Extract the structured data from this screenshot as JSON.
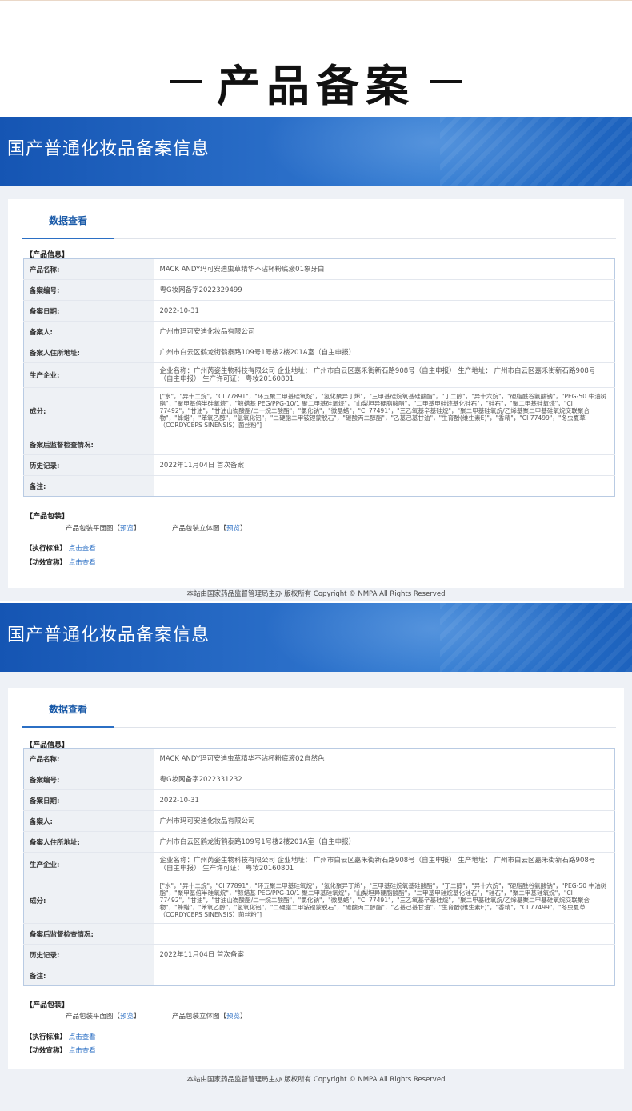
{
  "page_heading": {
    "dash_left": "—",
    "title": "产品备案",
    "dash_right": "—"
  },
  "banner_title": "国产普通化妆品备案信息",
  "tab_label": "数据查看",
  "labels": {
    "product_info": "【产品信息】",
    "product_name": "产品名称:",
    "record_no": "备案编号:",
    "record_date": "备案日期:",
    "registrant": "备案人:",
    "registrant_address": "备案人住所地址:",
    "manufacturer": "生产企业:",
    "ingredients": "成分:",
    "post_check": "备案后监督检查情况:",
    "history": "历史记录:",
    "remarks": "备注:",
    "packaging": "【产品包装】",
    "pkg_flat": "产品包装平面图",
    "pkg_3d": "产品包装立体图",
    "preview": "预览",
    "bracket_open": "【",
    "bracket_close": "】",
    "standard": "【执行标准】",
    "claims": "【功效宣称】",
    "view_link": "点击查看"
  },
  "footer": "本站由国家药品监督管理局主办 版权所有 Copyright © NMPA All Rights Reserved",
  "records": [
    {
      "product_name": "MACK ANDY玛可安迪虫草精华不沾杯粉底液01象牙白",
      "record_no": "粤G妆网备字2022329499",
      "record_date": "2022-10-31",
      "registrant": "广州市玛可安迪化妆品有限公司",
      "registrant_address": "广州市白云区鹤龙街鹤泰路109号1号楼2楼201A室（自主申报）",
      "manufacturer": "企业名称：广州芮姿生物科技有限公司 企业地址：  广州市白云区嘉禾街新石路908号（自主申报） 生产地址：  广州市白云区嘉禾街新石路908号（自主申报） 生产许可证：  粤妆20160801",
      "ingredients": "[\"水\"，\"异十二烷\"，\"CI 77891\"，\"环五聚二甲基硅氧烷\"，\"氢化聚异丁烯\"，\"三甲基硅烷氧基硅酸酯\"，\"丁二醇\"，\"异十六烷\"，\"硬脂酰谷氨酸钠\"，\"PEG-50 牛油树脂\"，\"聚甲基倍半硅氧烷\"，\"鲸蜡基 PEG/PPG-10/1 聚二甲基硅氧烷\"，\"山梨坦异硬脂酸酯\"，\"二甲基甲硅烷基化硅石\"，\"硅石\"，\"聚二甲基硅氧烷\"，\"CI 77492\"，\"甘油\"，\"甘油山嵛酸酯/二十烷二酸酯\"，\"氯化钠\"，\"微晶蜡\"，\"CI 77491\"，\"三乙氧基辛基硅烷\"，\"聚二甲基硅氧烷/乙烯基聚二甲基硅氧烷交联聚合物\"，\"蜂蜡\"，\"苯氧乙醇\"，\"氢氧化铝\"，\"二硬脂二甲铵锂蒙脱石\"，\"碳酸丙二醇酯\"，\"乙基己基甘油\"，\"生育酚(维生素E)\"，\"香精\"，\"CI 77499\"，\"冬虫夏草（CORDYCEPS SINENSIS）菌丝粉\"]",
      "post_check": "",
      "history": "2022年11月04日 首次备案",
      "remarks": ""
    },
    {
      "product_name": "MACK ANDY玛可安迪虫草精华不沾杯粉底液02自然色",
      "record_no": "粤G妆网备字2022331232",
      "record_date": "2022-10-31",
      "registrant": "广州市玛可安迪化妆品有限公司",
      "registrant_address": "广州市白云区鹤龙街鹤泰路109号1号楼2楼201A室（自主申报）",
      "manufacturer": "企业名称：广州芮姿生物科技有限公司 企业地址：  广州市白云区嘉禾街新石路908号（自主申报） 生产地址：  广州市白云区嘉禾街新石路908号（自主申报） 生产许可证：  粤妆20160801",
      "ingredients": "[\"水\"，\"异十二烷\"，\"CI 77891\"，\"环五聚二甲基硅氧烷\"，\"氢化聚异丁烯\"，\"三甲基硅烷氧基硅酸酯\"，\"丁二醇\"，\"异十六烷\"，\"硬脂酰谷氨酸钠\"，\"PEG-50 牛油树脂\"，\"聚甲基倍半硅氧烷\"，\"鲸蜡基 PEG/PPG-10/1 聚二甲基硅氧烷\"，\"山梨坦异硬脂酸酯\"，\"二甲基甲硅烷基化硅石\"，\"硅石\"，\"聚二甲基硅氧烷\"，\"CI 77492\"，\"甘油\"，\"甘油山嵛酸酯/二十烷二酸酯\"，\"氯化钠\"，\"微晶蜡\"，\"CI 77491\"，\"三乙氧基辛基硅烷\"，\"聚二甲基硅氧烷/乙烯基聚二甲基硅氧烷交联聚合物\"，\"蜂蜡\"，\"苯氧乙醇\"，\"氢氧化铝\"，\"二硬脂二甲铵锂蒙脱石\"，\"碳酸丙二醇酯\"，\"乙基己基甘油\"，\"生育酚(维生素E)\"，\"香精\"，\"CI 77499\"，\"冬虫夏草（CORDYCEPS SINENSIS）菌丝粉\"]",
      "post_check": "",
      "history": "2022年11月04日 首次备案",
      "remarks": ""
    }
  ]
}
